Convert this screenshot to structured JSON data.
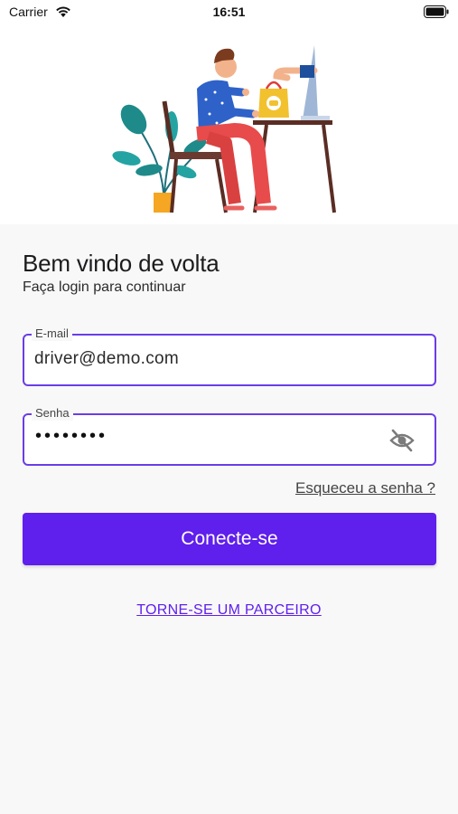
{
  "status_bar": {
    "carrier": "Carrier",
    "time": "16:51"
  },
  "login": {
    "title": "Bem vindo de volta",
    "subtitle": "Faça login para continuar",
    "email_label": "E-mail",
    "email_value": "driver@demo.com",
    "password_label": "Senha",
    "password_mask": "••••••••",
    "forgot_link": "Esqueceu a senha ?",
    "submit_label": "Conecte-se",
    "partner_link": "TORNE-SE UM PARCEIRO"
  },
  "icons": {
    "wifi": "wifi-icon",
    "battery": "battery-icon",
    "password_toggle": "eye-off-icon"
  },
  "colors": {
    "accent": "#5f1fec",
    "field_border": "#6a3de8",
    "background": "#f8f8f8"
  }
}
